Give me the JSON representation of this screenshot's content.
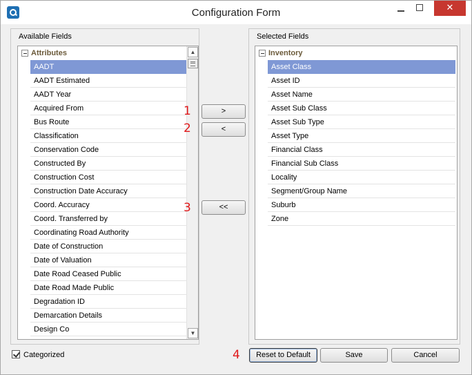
{
  "window": {
    "title": "Configuration Form",
    "close_glyph": "✕"
  },
  "available": {
    "label": "Available Fields",
    "category": "Attributes",
    "items": [
      "AADT",
      "AADT Estimated",
      "AADT Year",
      "Acquired From",
      "Bus Route",
      "Classification",
      "Conservation Code",
      "Constructed By",
      "Construction Cost",
      "Construction Date Accuracy",
      "Coord. Accuracy",
      "Coord. Transferred by",
      "Coordinating Road Authority",
      "Date of Construction",
      "Date of Valuation",
      "Date Road Ceased Public",
      "Date Road Made Public",
      "Degradation ID",
      "Demarcation Details",
      "Design Co"
    ],
    "selected_index": 0
  },
  "selected": {
    "label": "Selected Fields",
    "category": "Inventory",
    "items": [
      "Asset Class",
      "Asset ID",
      "Asset Name",
      "Asset Sub Class",
      "Asset Sub Type",
      "Asset Type",
      "Financial Class",
      "Financial Sub Class",
      "Locality",
      "Segment/Group Name",
      "Suburb",
      "Zone"
    ],
    "selected_index": 0
  },
  "transfer": {
    "add_label": ">",
    "remove_label": "<",
    "remove_all_label": "<<"
  },
  "markers": {
    "m1": "1",
    "m2": "2",
    "m3": "3",
    "m4": "4"
  },
  "footer": {
    "categorized_label": "Categorized",
    "categorized_checked": true,
    "reset_label": "Reset to Default",
    "save_label": "Save",
    "cancel_label": "Cancel"
  },
  "icons": {
    "scroll_up": "▲",
    "scroll_down": "▼",
    "app_icon": "app-icon",
    "collapse": "minus-box-icon"
  },
  "colors": {
    "selection": "#7f98d5",
    "marker": "#e0191b",
    "close": "#c7372f",
    "category_text": "#6b5a3a"
  }
}
